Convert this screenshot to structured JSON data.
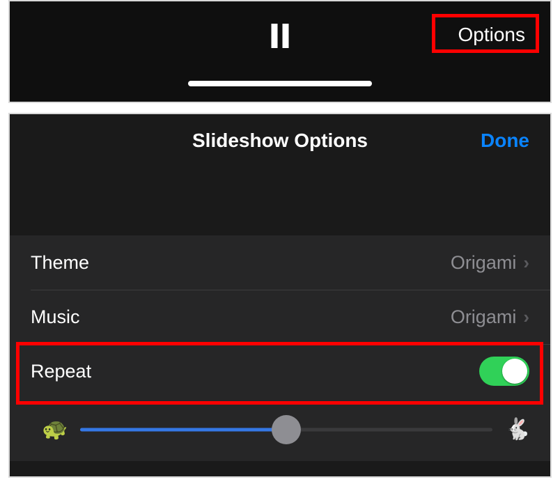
{
  "player": {
    "options_label": "Options"
  },
  "sheet": {
    "title": "Slideshow Options",
    "done_label": "Done",
    "rows": {
      "theme": {
        "label": "Theme",
        "value": "Origami"
      },
      "music": {
        "label": "Music",
        "value": "Origami"
      },
      "repeat": {
        "label": "Repeat",
        "on": true
      }
    },
    "speed": {
      "slow_icon": "turtle-icon",
      "fast_icon": "rabbit-icon",
      "percent": 50
    }
  }
}
